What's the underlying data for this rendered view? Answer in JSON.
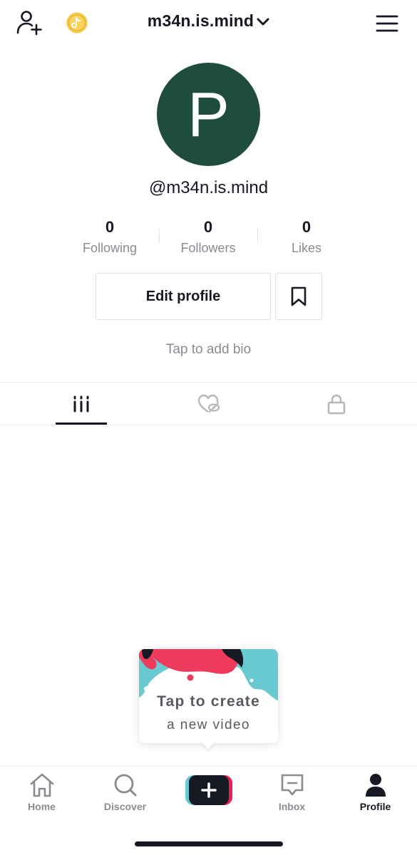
{
  "header": {
    "username_title": "m34n.is.mind",
    "add_friend_icon": "person-add-icon",
    "coin_icon": "coin-icon",
    "menu_icon": "hamburger-menu-icon"
  },
  "profile": {
    "avatar_initial": "P",
    "avatar_color": "#1e4d40",
    "handle": "@m34n.is.mind",
    "stats": [
      {
        "value": "0",
        "label": "Following"
      },
      {
        "value": "0",
        "label": "Followers"
      },
      {
        "value": "0",
        "label": "Likes"
      }
    ],
    "edit_button": "Edit profile",
    "bookmark_icon": "bookmark-icon",
    "bio_placeholder": "Tap to add bio"
  },
  "tabs": [
    {
      "icon": "videos-grid-icon",
      "active": true
    },
    {
      "icon": "liked-hidden-icon",
      "active": false
    },
    {
      "icon": "lock-icon",
      "active": false
    }
  ],
  "tooltip": {
    "line1": "Tap to create",
    "line2": "a new video"
  },
  "bottom_nav": {
    "items": [
      {
        "label": "Home",
        "icon": "home-icon",
        "active": false
      },
      {
        "label": "Discover",
        "icon": "search-icon",
        "active": false
      },
      {
        "label": "",
        "icon": "plus-icon",
        "active": false
      },
      {
        "label": "Inbox",
        "icon": "inbox-icon",
        "active": false
      },
      {
        "label": "Profile",
        "icon": "profile-icon",
        "active": true
      }
    ]
  },
  "colors": {
    "brand_cyan": "#69c9d0",
    "brand_red": "#ee1d52",
    "text_primary": "#161823",
    "text_secondary": "#8a8b91"
  }
}
